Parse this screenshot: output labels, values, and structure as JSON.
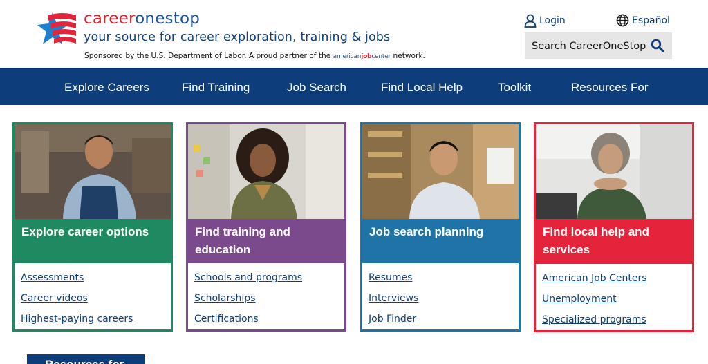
{
  "brand": {
    "name_part1": "career",
    "name_part2": "onestop",
    "tagline": "your source for career exploration, training & jobs"
  },
  "sponsor": {
    "before": "Sponsored by the U.S. Department of Labor. A proud partner of the",
    "ajc_part1": "american",
    "ajc_part2": "job",
    "ajc_part3": "center",
    "after": "network."
  },
  "header": {
    "login": "Login",
    "language": "Español",
    "search_label": "Search CareerOneStop"
  },
  "nav": {
    "items": [
      "Explore Careers",
      "Find Training",
      "Job Search",
      "Find Local Help",
      "Toolkit",
      "Resources For"
    ]
  },
  "cards": [
    {
      "title": "Explore career options",
      "color": "#1f8a61",
      "links": [
        "Assessments",
        "Career videos",
        "Highest-paying careers"
      ]
    },
    {
      "title": "Find training and education",
      "color": "#7b4a8c",
      "links": [
        "Schools and programs",
        "Scholarships",
        "Certifications"
      ]
    },
    {
      "title": "Job search planning",
      "color": "#1f73a6",
      "links": [
        "Resumes",
        "Interviews",
        "Job Finder"
      ]
    },
    {
      "title": "Find local help and services",
      "color": "#e3243a",
      "links": [
        "American Job Centers",
        "Unemployment",
        "Specialized programs"
      ]
    }
  ],
  "bottom_button": "Resources for",
  "colors": {
    "nav_bg": "#0d3d7a",
    "brand_red": "#d6232e",
    "brand_blue": "#1c4f9c"
  },
  "icons": {
    "login": "person-icon",
    "language": "globe-icon",
    "search": "search-icon",
    "logo": "flag-star-logo"
  }
}
